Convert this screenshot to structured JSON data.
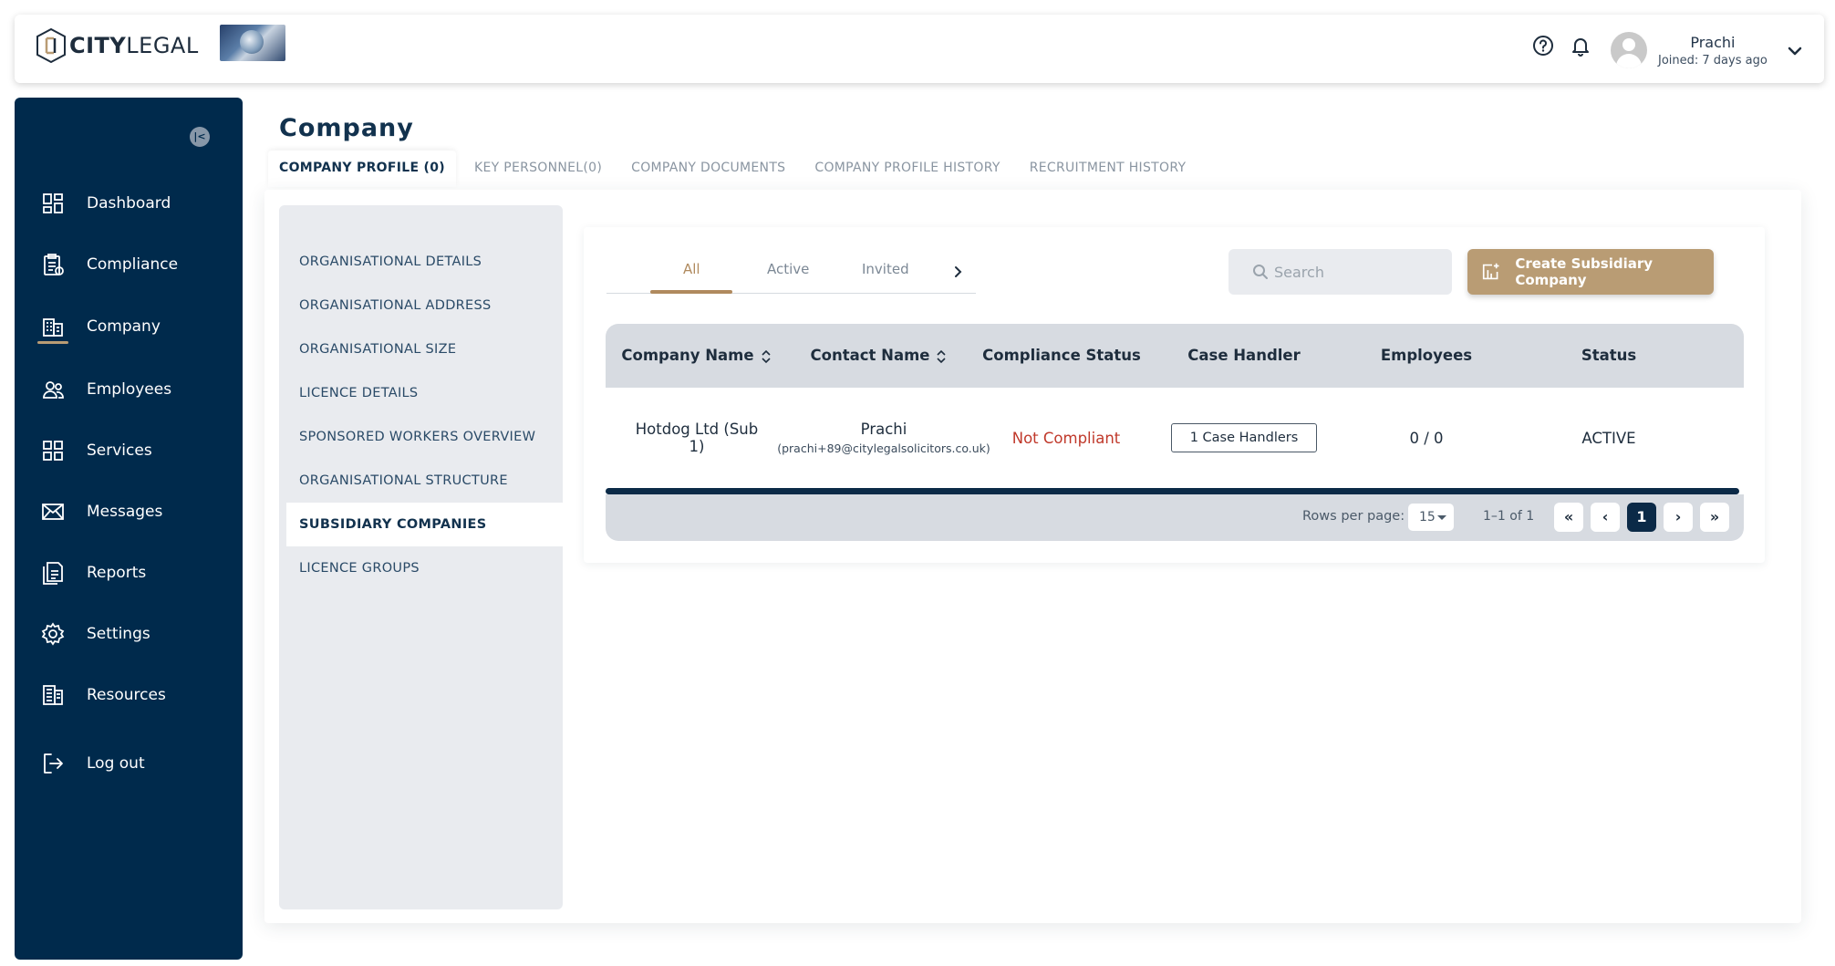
{
  "brand": {
    "logo_bold": "CITY",
    "logo_light": "LEGAL"
  },
  "user": {
    "name": "Prachi",
    "joined": "Joined: 7 days ago"
  },
  "sidebar": {
    "items": [
      {
        "label": "Dashboard",
        "icon": "dashboard-grid-icon"
      },
      {
        "label": "Compliance",
        "icon": "compliance-clipboard-icon"
      },
      {
        "label": "Company",
        "icon": "company-building-icon",
        "active": true
      },
      {
        "label": "Employees",
        "icon": "employees-users-icon"
      },
      {
        "label": "Services",
        "icon": "services-grid-icon"
      },
      {
        "label": "Messages",
        "icon": "envelope-icon"
      },
      {
        "label": "Reports",
        "icon": "reports-document-icon"
      },
      {
        "label": "Settings",
        "icon": "gear-icon"
      },
      {
        "label": "Resources",
        "icon": "resources-building-icon"
      },
      {
        "label": "Log out",
        "icon": "logout-icon"
      }
    ]
  },
  "page": {
    "title": "Company"
  },
  "tabs": [
    "COMPANY PROFILE (0)",
    "KEY PERSONNEL(0)",
    "COMPANY DOCUMENTS",
    "COMPANY PROFILE HISTORY",
    "RECRUITMENT HISTORY"
  ],
  "profile_menu": [
    "ORGANISATIONAL DETAILS",
    "ORGANISATIONAL ADDRESS",
    "ORGANISATIONAL SIZE",
    "LICENCE DETAILS",
    "SPONSORED WORKERS OVERVIEW",
    "ORGANISATIONAL STRUCTURE",
    "SUBSIDIARY COMPANIES",
    "LICENCE GROUPS"
  ],
  "filters": {
    "all": "All",
    "active": "Active",
    "invited": "Invited"
  },
  "search": {
    "placeholder": "Search"
  },
  "create_button": "Create Subsidiary Company",
  "table": {
    "headers": [
      "Company Name",
      "Contact Name",
      "Compliance Status",
      "Case Handler",
      "Employees",
      "Status"
    ],
    "rows": [
      {
        "company": "Hotdog Ltd (Sub 1)",
        "contact_name": "Prachi",
        "contact_email": "(prachi+89@citylegalsolicitors.co.uk)",
        "compliance": "Not Compliant",
        "case_handler": "1 Case Handlers",
        "employees": "0 / 0",
        "status": "ACTIVE"
      }
    ]
  },
  "pagination": {
    "rows_per_page_label": "Rows per page:",
    "rows_per_page": "15",
    "range": "1–1 of 1",
    "current_page": "1"
  },
  "colors": {
    "sidebar": "#002a4c",
    "accent": "#b99c74",
    "danger": "#c0392b"
  }
}
